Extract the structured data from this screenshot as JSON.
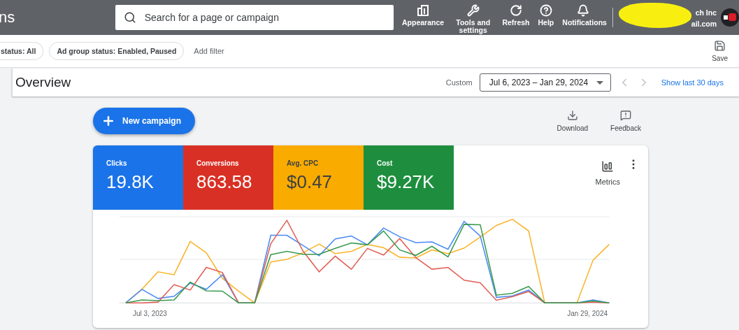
{
  "header": {
    "title": "ns",
    "search": {
      "placeholder": "Search for a page or campaign"
    },
    "nav": [
      {
        "kind": "appearance",
        "label": "Appearance"
      },
      {
        "kind": "tools",
        "label": "Tools and settings"
      },
      {
        "kind": "refresh",
        "label": "Refresh"
      },
      {
        "kind": "help",
        "label": "Help"
      },
      {
        "kind": "notifications",
        "label": "Notifications"
      }
    ],
    "account": {
      "name": "ch Inc",
      "email": "ail.com"
    }
  },
  "filters": {
    "chips": [
      "status: All",
      "Ad group status: Enabled, Paused"
    ],
    "add": "Add filter",
    "save": "Save"
  },
  "overview": {
    "title": "Overview",
    "range_label": "Custom",
    "range": "Jul 6, 2023 – Jan 29, 2024",
    "show_last": "Show last 30 days"
  },
  "actions": {
    "new_campaign": "New campaign",
    "download": "Download",
    "feedback": "Feedback"
  },
  "metrics": [
    {
      "label": "Clicks",
      "value": "19.8K",
      "selected": true,
      "color": "#1a73e8"
    },
    {
      "label": "Conversions",
      "value": "863.58",
      "selected": true,
      "color": "#d93025"
    },
    {
      "label": "Avg. CPC",
      "value": "$0.47",
      "selected": true,
      "color": "#f9ab00"
    },
    {
      "label": "Cost",
      "value": "$9.27K",
      "selected": true,
      "color": "#1e8e3e"
    }
  ],
  "metrics_button": "Metrics",
  "chart": {
    "start_label": "Jul 3, 2023",
    "end_label": "Jan 29, 2024"
  }
}
